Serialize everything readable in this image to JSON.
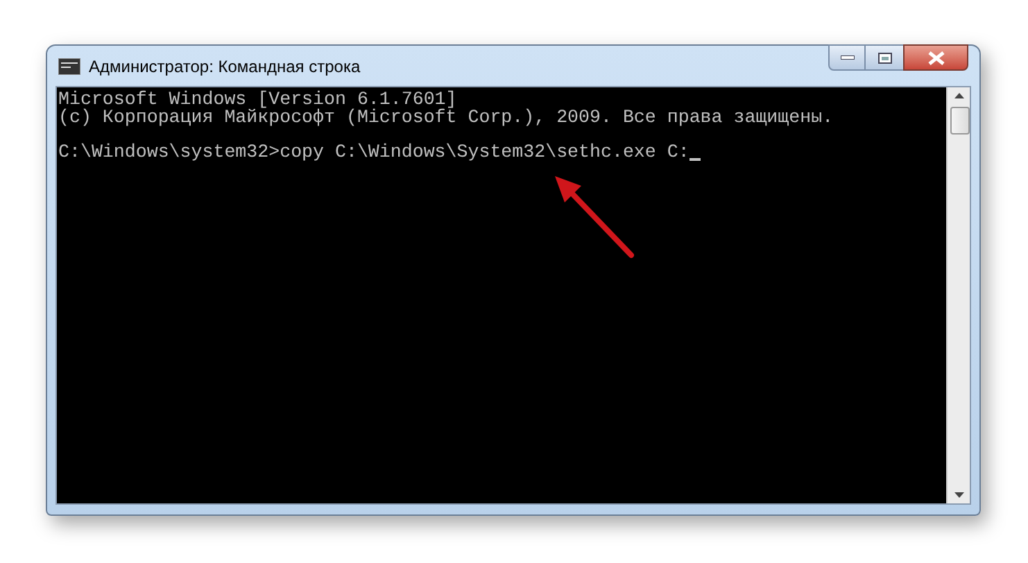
{
  "window": {
    "title": "Администратор: Командная строка"
  },
  "console": {
    "blocks": [
      [
        "Microsoft Windows [Version 6.1.7601]",
        "(c) Корпорация Майкрософт (Microsoft Corp.), 2009. Все права защищены."
      ],
      [
        "C:\\Windows\\system32>copy C:\\Windows\\System32\\sethc.exe C:"
      ]
    ],
    "cursor": true
  }
}
